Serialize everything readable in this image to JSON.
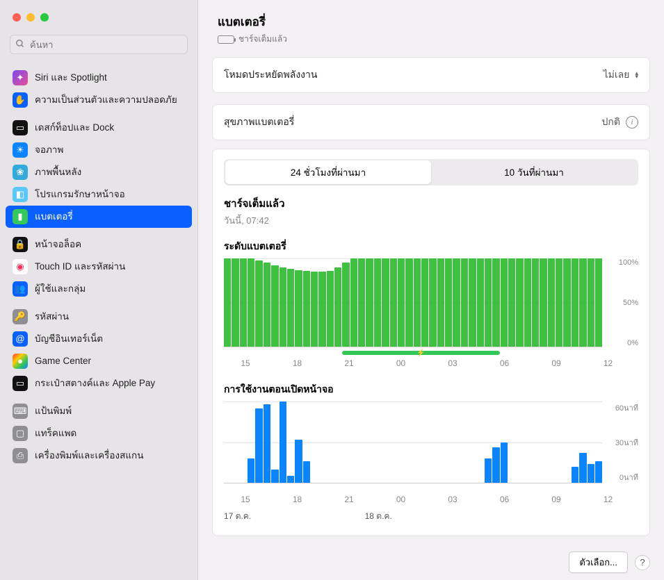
{
  "search": {
    "placeholder": "ค้นหา"
  },
  "sidebar": {
    "groups": [
      [
        {
          "label": "Siri และ Spotlight",
          "icon_bg": "linear-gradient(135deg,#7a4de8,#e84d9b)",
          "glyph": "✦"
        },
        {
          "label": "ความเป็นส่วนตัวและความปลอดภัย",
          "icon_bg": "#0a60ff",
          "glyph": "✋"
        }
      ],
      [
        {
          "label": "เดสก์ท็อปและ Dock",
          "icon_bg": "#111",
          "glyph": "▭"
        },
        {
          "label": "จอภาพ",
          "icon_bg": "#0a84ff",
          "glyph": "☀"
        },
        {
          "label": "ภาพพื้นหลัง",
          "icon_bg": "#34aadc",
          "glyph": "❀"
        },
        {
          "label": "โปรแกรมรักษาหน้าจอ",
          "icon_bg": "#5ac8fa",
          "glyph": "◧"
        },
        {
          "label": "แบตเตอรี่",
          "icon_bg": "#34c759",
          "glyph": "▮",
          "selected": true
        }
      ],
      [
        {
          "label": "หน้าจอล็อค",
          "icon_bg": "#111",
          "glyph": "🔒"
        },
        {
          "label": "Touch ID และรหัสผ่าน",
          "icon_bg": "#fff",
          "glyph": "◉",
          "glyph_color": "#ff2d55"
        },
        {
          "label": "ผู้ใช้และกลุ่ม",
          "icon_bg": "#0a60ff",
          "glyph": "👥"
        }
      ],
      [
        {
          "label": "รหัสผ่าน",
          "icon_bg": "#8e8e93",
          "glyph": "🔑"
        },
        {
          "label": "บัญชีอินเทอร์เน็ต",
          "icon_bg": "#0a60ff",
          "glyph": "@"
        },
        {
          "label": "Game Center",
          "icon_bg": "linear-gradient(135deg,#ff3b30,#ffcc00,#34c759,#0a84ff)",
          "glyph": "●"
        },
        {
          "label": "กระเป๋าสตางค์และ Apple Pay",
          "icon_bg": "#111",
          "glyph": "▭"
        }
      ],
      [
        {
          "label": "แป้นพิมพ์",
          "icon_bg": "#8e8e93",
          "glyph": "⌨"
        },
        {
          "label": "แทร็คแพด",
          "icon_bg": "#8e8e93",
          "glyph": "▢"
        },
        {
          "label": "เครื่องพิมพ์และเครื่องสแกน",
          "icon_bg": "#8e8e93",
          "glyph": "⎙"
        }
      ]
    ]
  },
  "header": {
    "title": "แบตเตอรี่",
    "status": "ชาร์จเต็มแล้ว"
  },
  "rows": {
    "low_power": {
      "label": "โหมดประหยัดพลังงาน",
      "value": "ไม่เลย"
    },
    "health": {
      "label": "สุขภาพแบตเตอรี่",
      "value": "ปกติ"
    }
  },
  "segmented": {
    "a": "24 ชั่วโมงที่ผ่านมา",
    "b": "10 วันที่ผ่านมา"
  },
  "charge_info": {
    "title": "ชาร์จเต็มแล้ว",
    "subtitle": "วันนี้, 07:42"
  },
  "chart_level_title": "ระดับแบตเตอรี่",
  "chart_usage_title": "การใช้งานตอนเปิดหน้าจอ",
  "y_labels_level": [
    "100%",
    "50%",
    "0%"
  ],
  "y_labels_usage": [
    "60นาที",
    "30นาที",
    "0นาที"
  ],
  "x_ticks": [
    "15",
    "18",
    "21",
    "00",
    "03",
    "06",
    "09",
    "12"
  ],
  "date_labels": [
    "17 ต.ค.",
    "18 ต.ค."
  ],
  "footer": {
    "options": "ตัวเลือก..."
  },
  "chart_data": [
    {
      "type": "bar",
      "title": "ระดับแบตเตอรี่",
      "ylabel": "%",
      "ylim": [
        0,
        100
      ],
      "x_hours": [
        "14",
        "14.5",
        "15",
        "15.5",
        "16",
        "16.5",
        "17",
        "17.5",
        "18",
        "18.5",
        "19",
        "19.5",
        "20",
        "20.5",
        "21",
        "21.5",
        "22",
        "22.5",
        "23",
        "23.5",
        "00",
        "00.5",
        "01",
        "01.5",
        "02",
        "02.5",
        "03",
        "03.5",
        "04",
        "04.5",
        "05",
        "05.5",
        "06",
        "06.5",
        "07",
        "07.5",
        "08",
        "08.5",
        "09",
        "09.5",
        "10",
        "10.5",
        "11",
        "11.5",
        "12",
        "12.5",
        "13",
        "13.5"
      ],
      "values": [
        100,
        100,
        100,
        100,
        98,
        95,
        92,
        90,
        88,
        87,
        86,
        85,
        85,
        86,
        90,
        95,
        100,
        100,
        100,
        100,
        100,
        100,
        100,
        100,
        100,
        100,
        100,
        100,
        100,
        100,
        100,
        100,
        100,
        100,
        100,
        100,
        100,
        100,
        100,
        100,
        100,
        100,
        100,
        100,
        100,
        100,
        100,
        100
      ],
      "charging_range_hours": [
        21.5,
        7.5
      ]
    },
    {
      "type": "bar",
      "title": "การใช้งานตอนเปิดหน้าจอ",
      "ylabel": "นาที",
      "ylim": [
        0,
        60
      ],
      "x_hours": [
        "14",
        "14.5",
        "15",
        "15.5",
        "16",
        "16.5",
        "17",
        "17.5",
        "18",
        "18.5",
        "19",
        "19.5",
        "20",
        "20.5",
        "21",
        "21.5",
        "22",
        "22.5",
        "23",
        "23.5",
        "00",
        "00.5",
        "01",
        "01.5",
        "02",
        "02.5",
        "03",
        "03.5",
        "04",
        "04.5",
        "05",
        "05.5",
        "06",
        "06.5",
        "07",
        "07.5",
        "08",
        "08.5",
        "09",
        "09.5",
        "10",
        "10.5",
        "11",
        "11.5",
        "12",
        "12.5",
        "13",
        "13.5"
      ],
      "values": [
        0,
        0,
        0,
        18,
        55,
        58,
        10,
        60,
        5,
        32,
        16,
        0,
        0,
        0,
        0,
        0,
        0,
        0,
        0,
        0,
        0,
        0,
        0,
        0,
        0,
        0,
        0,
        0,
        0,
        0,
        0,
        0,
        0,
        18,
        26,
        30,
        0,
        0,
        0,
        0,
        0,
        0,
        0,
        0,
        12,
        22,
        14,
        16
      ]
    }
  ]
}
